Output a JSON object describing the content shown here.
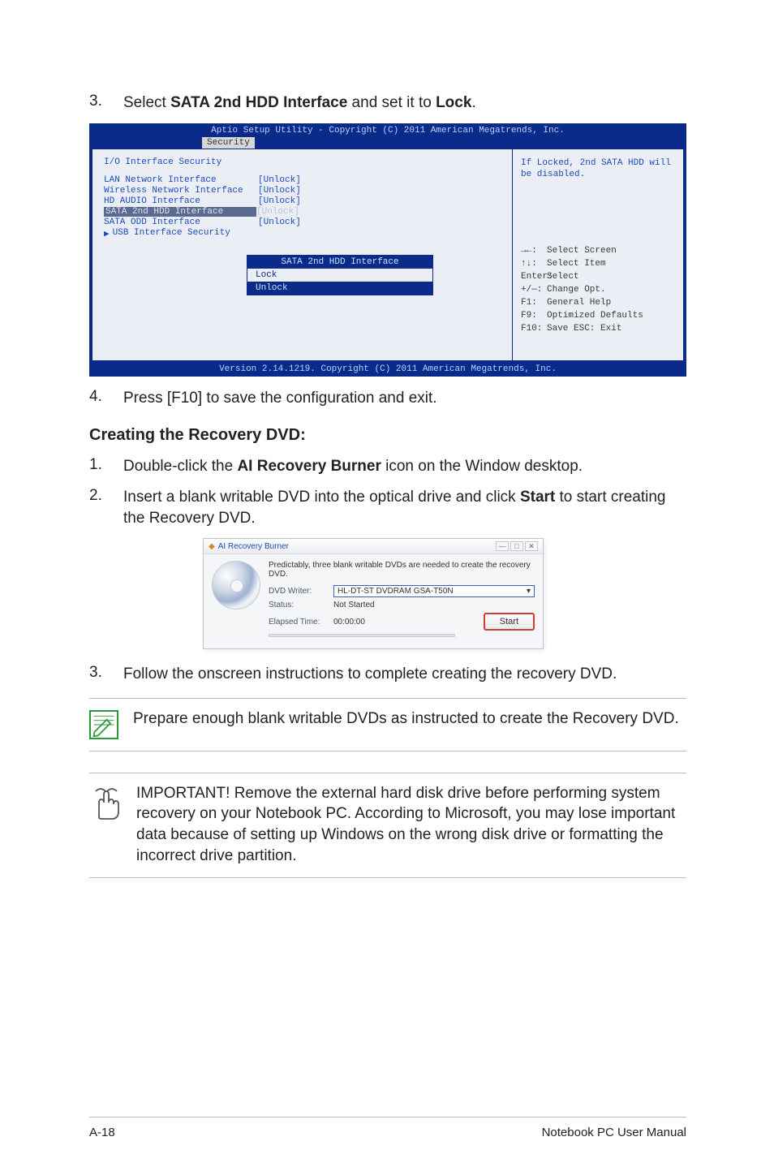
{
  "step3": {
    "num": "3.",
    "pre": "Select ",
    "bold1": "SATA 2nd HDD Interface",
    "mid": " and set it to ",
    "bold2": "Lock",
    "post": "."
  },
  "bios": {
    "top": "Aptio Setup Utility - Copyright (C) 2011 American Megatrends, Inc.",
    "tab": "Security",
    "heading": "I/O Interface Security",
    "rows": [
      {
        "name": "LAN Network Interface",
        "val": "[Unlock]"
      },
      {
        "name": "Wireless Network Interface",
        "val": "[Unlock]"
      },
      {
        "name": "HD AUDIO Interface",
        "val": "[Unlock]"
      },
      {
        "name": "SATA 2nd HDD Interface",
        "val": "[Unlock]",
        "selected": true
      },
      {
        "name": "SATA ODD Interface",
        "val": "[Unlock]"
      }
    ],
    "submenu": "USB Interface Security",
    "popup_title": "SATA 2nd HDD Interface",
    "popup_opts": [
      "Lock",
      "Unlock"
    ],
    "help": "If Locked, 2nd SATA HDD will be disabled.",
    "keys": [
      {
        "k": "→←:",
        "t": "Select Screen"
      },
      {
        "k": "↑↓:",
        "t": "Select Item"
      },
      {
        "k": "Enter:",
        "t": "Select"
      },
      {
        "k": "+/—:",
        "t": "Change Opt."
      },
      {
        "k": "F1:",
        "t": "General Help"
      },
      {
        "k": "F9:",
        "t": "Optimized Defaults"
      },
      {
        "k": "F10:",
        "t": "Save   ESC: Exit"
      }
    ],
    "footer": "Version 2.14.1219. Copyright (C) 2011 American Megatrends, Inc."
  },
  "step4": {
    "num": "4.",
    "text": "Press [F10] to save the configuration and exit."
  },
  "section": "Creating the Recovery DVD:",
  "c1": {
    "num": "1.",
    "pre": "Double-click the ",
    "bold": "AI Recovery Burner",
    "post": " icon on the Window desktop."
  },
  "c2": {
    "num": "2.",
    "pre": "Insert a blank writable DVD into the optical drive and click ",
    "bold": "Start",
    "post": " to start creating the Recovery DVD."
  },
  "ai": {
    "title": "AI Recovery Burner",
    "note": "Predictably, three blank writable DVDs are needed to create the recovery DVD.",
    "writer_lbl": "DVD Writer:",
    "writer_val": "HL-DT-ST DVDRAM GSA-T50N",
    "status_lbl": "Status:",
    "status_val": "Not Started",
    "elapsed_lbl": "Elapsed Time:",
    "elapsed_val": "00:00:00",
    "start": "Start"
  },
  "c3": {
    "num": "3.",
    "text": "Follow the onscreen instructions to complete creating the recovery DVD."
  },
  "note": "Prepare enough blank writable DVDs as instructed to create the Recovery DVD.",
  "important": "IMPORTANT! Remove the external hard disk drive before performing system recovery on your Notebook PC. According to Microsoft, you may lose important data because of setting up Windows on the wrong disk drive or formatting the incorrect drive partition.",
  "footer_left": "A-18",
  "footer_right": "Notebook PC User Manual"
}
